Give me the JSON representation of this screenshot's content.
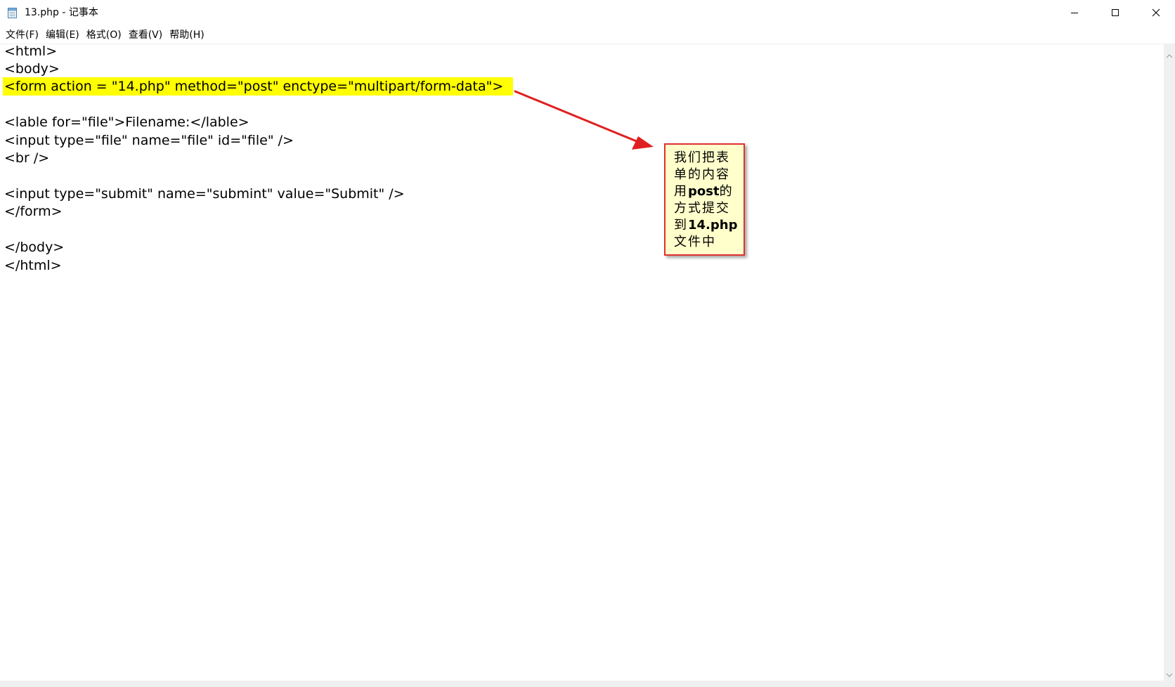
{
  "window": {
    "title": "13.php - 记事本",
    "controls": {
      "minimize_icon": "minimize-icon",
      "maximize_icon": "maximize-icon",
      "close_icon": "close-icon"
    }
  },
  "menu": {
    "items": [
      {
        "label": "文件(F)"
      },
      {
        "label": "编辑(E)"
      },
      {
        "label": "格式(O)"
      },
      {
        "label": "查看(V)"
      },
      {
        "label": "帮助(H)"
      }
    ]
  },
  "editor": {
    "lines": [
      "<html>",
      "<body>",
      "<form action = \"14.php\" method=\"post\" enctype=\"multipart/form-data\">",
      "",
      "<lable for=\"file\">Filename:</lable>",
      "<input type=\"file\" name=\"file\" id=\"file\" />",
      "<br />",
      "",
      "<input type=\"submit\" name=\"submint\" value=\"Submit\" />",
      "</form>",
      "",
      "</body>",
      "</html>"
    ],
    "highlight_color": "#ffff00"
  },
  "annotation": {
    "lines": [
      {
        "pre": "我们把表",
        "bold": "",
        "post": ""
      },
      {
        "pre": "单的内容",
        "bold": "",
        "post": ""
      },
      {
        "pre": "用",
        "bold": "post",
        "post": "的"
      },
      {
        "pre": "方式提交",
        "bold": "",
        "post": ""
      },
      {
        "pre": "到",
        "bold": "14.php",
        "post": ""
      },
      {
        "pre": "文件中",
        "bold": "",
        "post": ""
      }
    ],
    "background": "#ffffcc",
    "border_color": "#e03030",
    "arrow_color": "#e02020"
  }
}
